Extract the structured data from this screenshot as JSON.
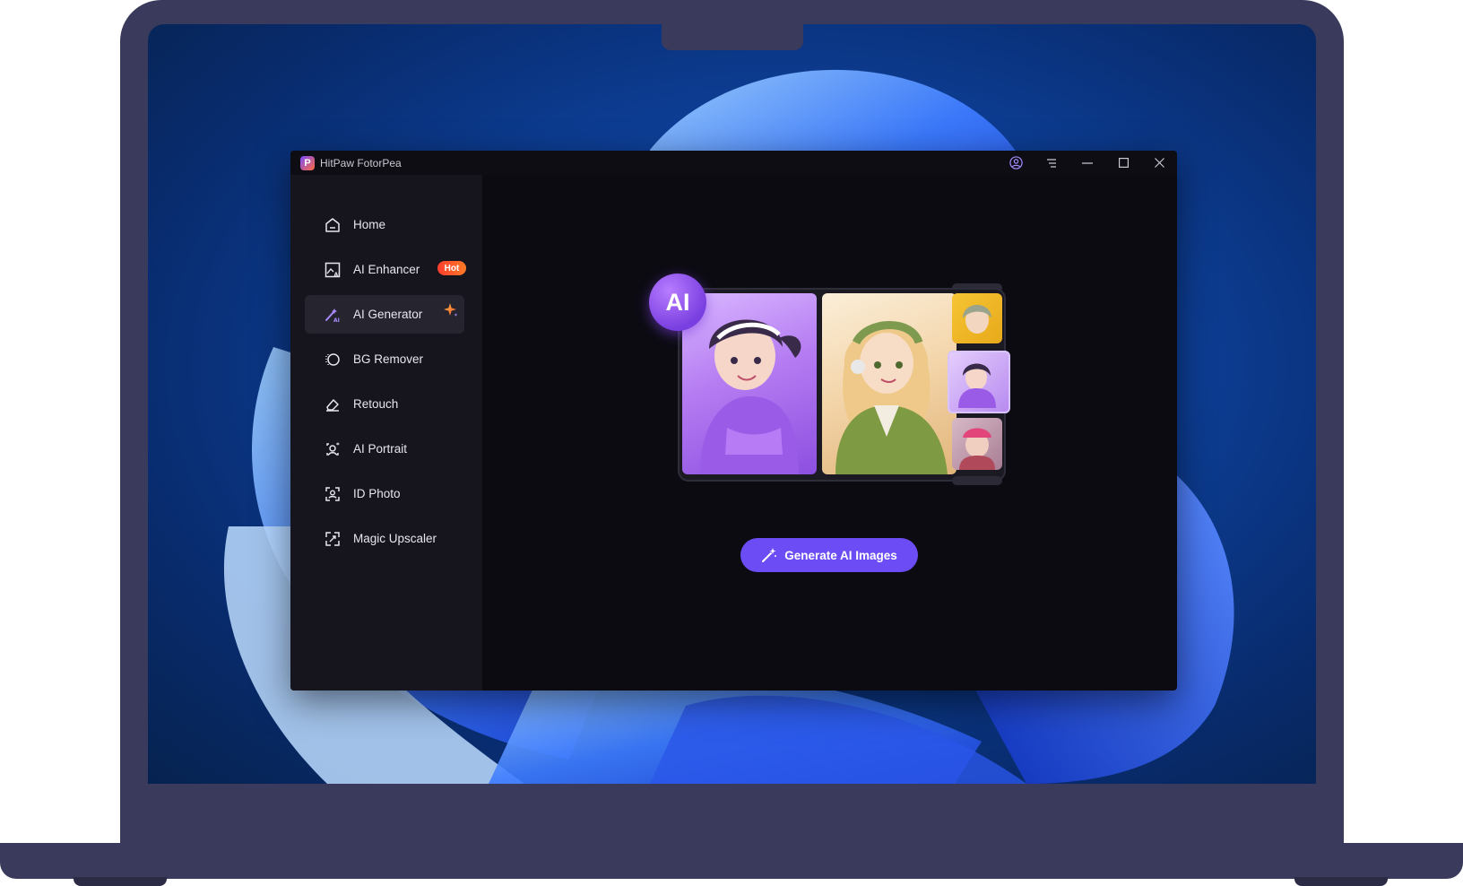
{
  "window": {
    "title": "HitPaw FotorPea",
    "logo_letter": "P"
  },
  "titlebar": {
    "icons": [
      "account-icon",
      "menu-icon",
      "minimize-icon",
      "maximize-icon",
      "close-icon"
    ]
  },
  "sidebar": {
    "items": [
      {
        "label": "Home",
        "icon": "home-icon"
      },
      {
        "label": "AI Enhancer",
        "icon": "ai-enhancer-icon"
      },
      {
        "label": "AI Generator",
        "icon": "ai-generator-icon"
      },
      {
        "label": "BG Remover",
        "icon": "bg-remover-icon"
      },
      {
        "label": "Retouch",
        "icon": "eraser-icon"
      },
      {
        "label": "AI Portrait",
        "icon": "ai-portrait-icon"
      },
      {
        "label": "ID Photo",
        "icon": "id-photo-icon"
      },
      {
        "label": "Magic Upscaler",
        "icon": "upscaler-icon"
      }
    ],
    "active_item": "AI Generator",
    "hot_badge": "Hot"
  },
  "main": {
    "ai_badge": "AI",
    "generate_button": "Generate AI Images"
  },
  "colors": {
    "accent": "#6c4cf5",
    "hot": "#ff4a2a",
    "window_bg": "#0c0b12",
    "sidebar_bg": "#16151d"
  }
}
